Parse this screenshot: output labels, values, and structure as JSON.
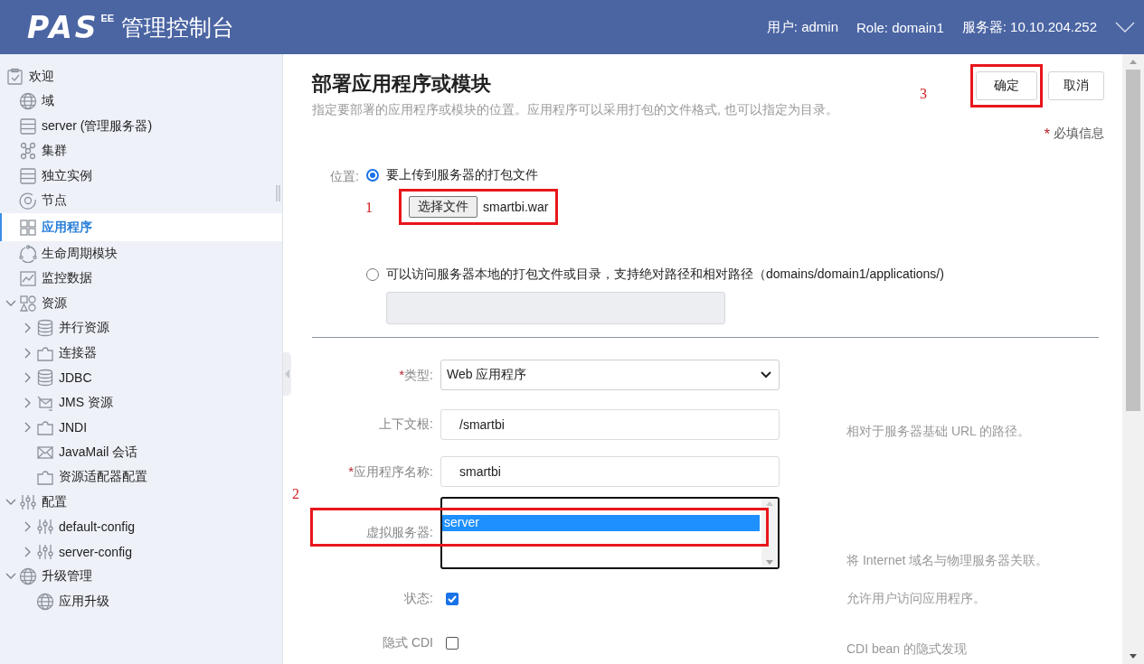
{
  "header": {
    "logo": "PAS",
    "logo_edition": "EE",
    "title": "管理控制台",
    "user": "用户: admin",
    "role": "Role: domain1",
    "server": "服务器: 10.10.204.252"
  },
  "sidebar": {
    "welcome": {
      "label": "欢迎",
      "selected": false
    },
    "items": [
      {
        "label": "域",
        "selected": false
      },
      {
        "label": "server (管理服务器)",
        "selected": false
      },
      {
        "label": "集群",
        "selected": false
      },
      {
        "label": "独立实例",
        "selected": false
      },
      {
        "label": "节点",
        "selected": false
      },
      {
        "label": "应用程序",
        "selected": true
      },
      {
        "label": "生命周期模块",
        "selected": false
      },
      {
        "label": "监控数据",
        "selected": false
      },
      {
        "label": "资源",
        "selected": false,
        "expanded": true,
        "children": [
          {
            "label": "并行资源",
            "selected": false,
            "expanded": false
          },
          {
            "label": "连接器",
            "selected": false,
            "expanded": false
          },
          {
            "label": "JDBC",
            "selected": false,
            "expanded": false
          },
          {
            "label": "JMS 资源",
            "selected": false,
            "expanded": false
          },
          {
            "label": "JNDI",
            "selected": false,
            "expanded": false
          },
          {
            "label": "JavaMail 会话",
            "selected": false
          },
          {
            "label": "资源适配器配置",
            "selected": false
          }
        ]
      },
      {
        "label": "配置",
        "selected": false,
        "expanded": true,
        "children": [
          {
            "label": "default-config",
            "selected": false,
            "expanded": false
          },
          {
            "label": "server-config",
            "selected": false,
            "expanded": false
          }
        ]
      },
      {
        "label": "升级管理",
        "selected": false,
        "expanded": true,
        "children": [
          {
            "label": "应用升级",
            "selected": false
          }
        ]
      }
    ]
  },
  "page": {
    "title": "部署应用程序或模块",
    "description": "指定要部署的应用程序或模块的位置。应用程序可以采用打包的文件格式, 也可以指定为目录。",
    "required_mark": "*",
    "required_note": "必填信息",
    "buttons": [
      {
        "label": "确定",
        "kind": "primary",
        "annotation": "3"
      },
      {
        "label": "取消",
        "kind": "secondary"
      }
    ],
    "location": {
      "label": "位置:",
      "options": [
        {
          "label": "要上传到服务器的打包文件",
          "selected": true,
          "file_button": "选择文件",
          "file_name": "smartbi.war",
          "annotation": "1"
        },
        {
          "label": "可以访问服务器本地的打包文件或目录，支持绝对路径和相对路径（domains/domain1/applications/)",
          "selected": false,
          "path_disabled": true
        }
      ]
    },
    "fields": [
      {
        "kind": "select",
        "label": "类型:",
        "required": true,
        "value": "Web 应用程序"
      },
      {
        "kind": "text",
        "label": "上下文根:",
        "required": false,
        "value": "/smartbi",
        "hint": "相对于服务器基础 URL 的路径。"
      },
      {
        "kind": "text",
        "label": "应用程序名称:",
        "required": true,
        "value": "smartbi"
      },
      {
        "kind": "listbox",
        "label": "虚拟服务器:",
        "required": false,
        "options": [
          {
            "label": "server",
            "selected": true
          }
        ],
        "hint": "将 Internet 域名与物理服务器关联。",
        "annotation": "2"
      },
      {
        "kind": "checkbox",
        "label": "状态:",
        "required": false,
        "checked": true,
        "hint": "允许用户访问应用程序。"
      },
      {
        "kind": "checkbox",
        "label": "隐式 CDI",
        "required": false,
        "checked": false,
        "hint": "CDI bean 的隐式发现"
      }
    ]
  }
}
